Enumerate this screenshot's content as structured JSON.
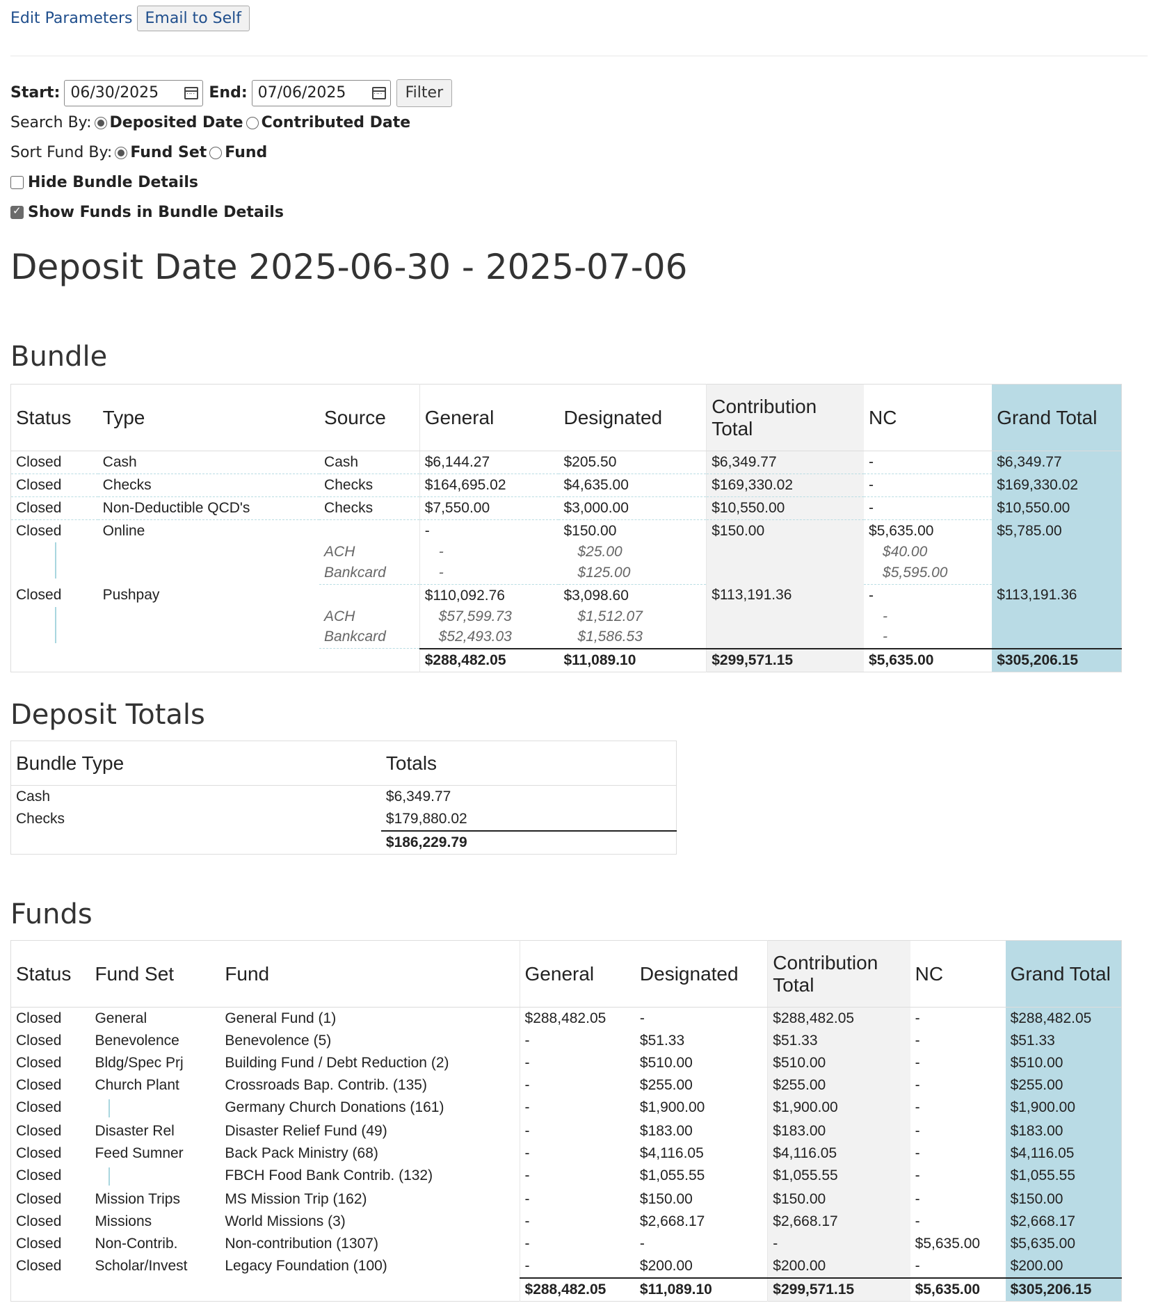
{
  "toolbar": {
    "edit_parameters": "Edit Parameters",
    "email_to_self": "Email to Self"
  },
  "filters": {
    "start_label": "Start:",
    "start_value": "06/30/2025",
    "end_label": "End:",
    "end_value": "07/06/2025",
    "filter_button": "Filter",
    "search_by_label": "Search By:",
    "search_by_options": [
      "Deposited Date",
      "Contributed Date"
    ],
    "search_by_selected": "Deposited Date",
    "sort_fund_label": "Sort Fund By:",
    "sort_fund_options": [
      "Fund Set",
      "Fund"
    ],
    "sort_fund_selected": "Fund Set",
    "hide_bundle_details": {
      "label": "Hide Bundle Details",
      "checked": false
    },
    "show_funds_in_bundle": {
      "label": "Show Funds in Bundle Details",
      "checked": true
    }
  },
  "page_title": "Deposit Date 2025-06-30 - 2025-07-06",
  "bundle": {
    "heading": "Bundle",
    "columns": [
      "Status",
      "Type",
      "Source",
      "General",
      "Designated",
      "Contribution Total",
      "NC",
      "Grand Total"
    ],
    "rows": [
      {
        "status": "Closed",
        "type": "Cash",
        "source": "Cash",
        "general": "$6,144.27",
        "designated": "$205.50",
        "contrib": "$6,349.77",
        "nc": "-",
        "grand": "$6,349.77",
        "sub": []
      },
      {
        "status": "Closed",
        "type": "Checks",
        "source": "Checks",
        "general": "$164,695.02",
        "designated": "$4,635.00",
        "contrib": "$169,330.02",
        "nc": "-",
        "grand": "$169,330.02",
        "sub": []
      },
      {
        "status": "Closed",
        "type": "Non-Deductible QCD's",
        "source": "Checks",
        "general": "$7,550.00",
        "designated": "$3,000.00",
        "contrib": "$10,550.00",
        "nc": "-",
        "grand": "$10,550.00",
        "sub": []
      },
      {
        "status": "Closed",
        "type": "Online",
        "source": "",
        "general": "-",
        "designated": "$150.00",
        "contrib": "$150.00",
        "nc": "$5,635.00",
        "grand": "$5,785.00",
        "sub": [
          {
            "source": "ACH",
            "general": "-",
            "designated": "$25.00",
            "nc": "$40.00"
          },
          {
            "source": "Bankcard",
            "general": "-",
            "designated": "$125.00",
            "nc": "$5,595.00"
          }
        ]
      },
      {
        "status": "Closed",
        "type": "Pushpay",
        "source": "",
        "general": "$110,092.76",
        "designated": "$3,098.60",
        "contrib": "$113,191.36",
        "nc": "-",
        "grand": "$113,191.36",
        "sub": [
          {
            "source": "ACH",
            "general": "$57,599.73",
            "designated": "$1,512.07",
            "nc": "-"
          },
          {
            "source": "Bankcard",
            "general": "$52,493.03",
            "designated": "$1,586.53",
            "nc": "-"
          }
        ]
      }
    ],
    "totals": {
      "general": "$288,482.05",
      "designated": "$11,089.10",
      "contrib": "$299,571.15",
      "nc": "$5,635.00",
      "grand": "$305,206.15"
    }
  },
  "deposit_totals": {
    "heading": "Deposit Totals",
    "columns": [
      "Bundle Type",
      "Totals"
    ],
    "rows": [
      {
        "type": "Cash",
        "total": "$6,349.77"
      },
      {
        "type": "Checks",
        "total": "$179,880.02"
      }
    ],
    "grand_total": "$186,229.79"
  },
  "funds": {
    "heading": "Funds",
    "columns": [
      "Status",
      "Fund Set",
      "Fund",
      "General",
      "Designated",
      "Contribution Total",
      "NC",
      "Grand Total"
    ],
    "rows": [
      {
        "status": "Closed",
        "fund_set": "General",
        "fund": "General Fund (1)",
        "general": "$288,482.05",
        "designated": "-",
        "contrib": "$288,482.05",
        "nc": "-",
        "grand": "$288,482.05"
      },
      {
        "status": "Closed",
        "fund_set": "Benevolence",
        "fund": "Benevolence (5)",
        "general": "-",
        "designated": "$51.33",
        "contrib": "$51.33",
        "nc": "-",
        "grand": "$51.33"
      },
      {
        "status": "Closed",
        "fund_set": "Bldg/Spec Prj",
        "fund": "Building Fund / Debt Reduction (2)",
        "general": "-",
        "designated": "$510.00",
        "contrib": "$510.00",
        "nc": "-",
        "grand": "$510.00"
      },
      {
        "status": "Closed",
        "fund_set": "Church Plant",
        "fund": "Crossroads Bap. Contrib. (135)",
        "general": "-",
        "designated": "$255.00",
        "contrib": "$255.00",
        "nc": "-",
        "grand": "$255.00"
      },
      {
        "status": "Closed",
        "fund_set": "",
        "fund": "Germany Church Donations (161)",
        "general": "-",
        "designated": "$1,900.00",
        "contrib": "$1,900.00",
        "nc": "-",
        "grand": "$1,900.00"
      },
      {
        "status": "Closed",
        "fund_set": "Disaster Rel",
        "fund": "Disaster Relief Fund (49)",
        "general": "-",
        "designated": "$183.00",
        "contrib": "$183.00",
        "nc": "-",
        "grand": "$183.00"
      },
      {
        "status": "Closed",
        "fund_set": "Feed Sumner",
        "fund": "Back Pack Ministry (68)",
        "general": "-",
        "designated": "$4,116.05",
        "contrib": "$4,116.05",
        "nc": "-",
        "grand": "$4,116.05"
      },
      {
        "status": "Closed",
        "fund_set": "",
        "fund": "FBCH Food Bank Contrib. (132)",
        "general": "-",
        "designated": "$1,055.55",
        "contrib": "$1,055.55",
        "nc": "-",
        "grand": "$1,055.55"
      },
      {
        "status": "Closed",
        "fund_set": "Mission Trips",
        "fund": "MS Mission Trip (162)",
        "general": "-",
        "designated": "$150.00",
        "contrib": "$150.00",
        "nc": "-",
        "grand": "$150.00"
      },
      {
        "status": "Closed",
        "fund_set": "Missions",
        "fund": "World Missions (3)",
        "general": "-",
        "designated": "$2,668.17",
        "contrib": "$2,668.17",
        "nc": "-",
        "grand": "$2,668.17"
      },
      {
        "status": "Closed",
        "fund_set": "Non-Contrib.",
        "fund": "Non-contribution (1307)",
        "general": "-",
        "designated": "-",
        "contrib": "-",
        "nc": "$5,635.00",
        "grand": "$5,635.00"
      },
      {
        "status": "Closed",
        "fund_set": "Scholar/Invest",
        "fund": "Legacy Foundation (100)",
        "general": "-",
        "designated": "$200.00",
        "contrib": "$200.00",
        "nc": "-",
        "grand": "$200.00"
      }
    ],
    "totals": {
      "general": "$288,482.05",
      "designated": "$11,089.10",
      "contrib": "$299,571.15",
      "nc": "$5,635.00",
      "grand": "$305,206.15"
    }
  }
}
